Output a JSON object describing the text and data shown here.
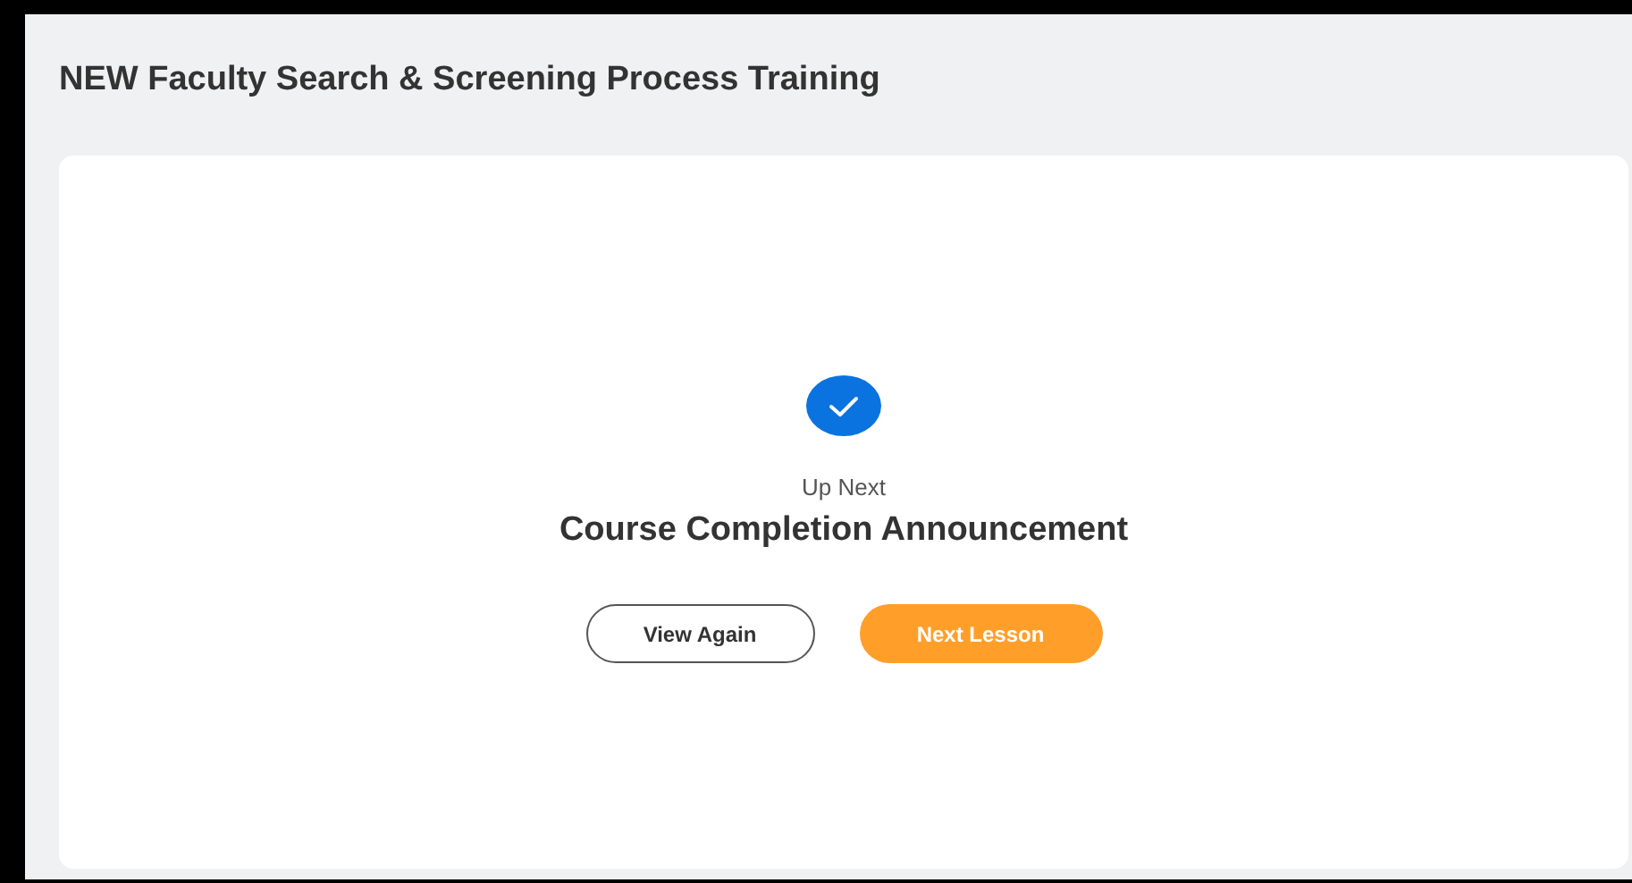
{
  "course_title": "NEW Faculty Search & Screening Process Training",
  "lesson": {
    "completed": true,
    "eyebrow": "Up Next",
    "next_title": "Course Completion Announcement"
  },
  "buttons": [
    {
      "label": "View Again",
      "kind": "outline"
    },
    {
      "label": "Next Lesson",
      "kind": "primary"
    }
  ]
}
